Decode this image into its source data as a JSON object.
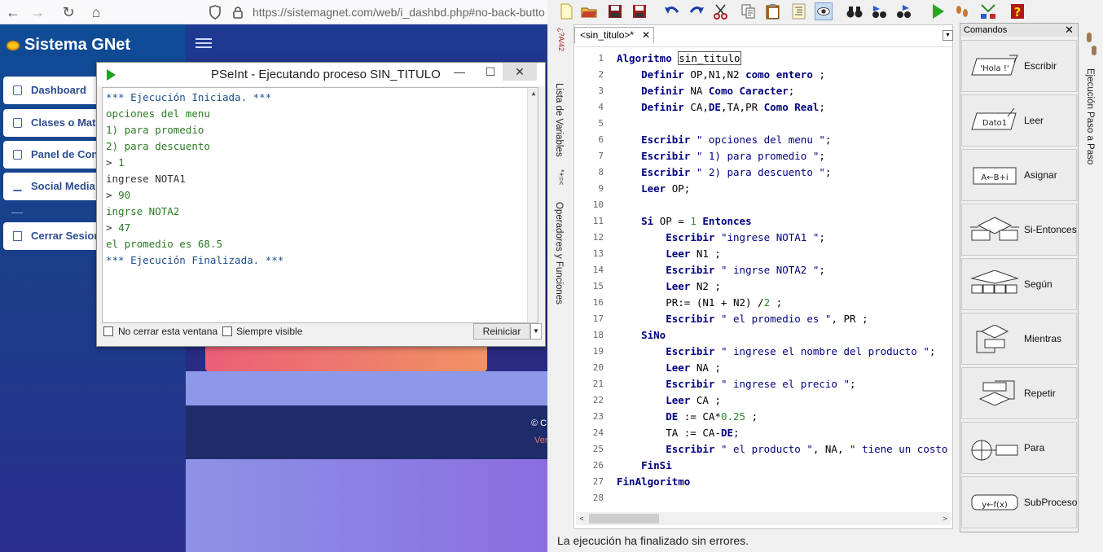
{
  "browser": {
    "url": "https://sistemagnet.com/web/i_dashbd.php#no-back-butto"
  },
  "site": {
    "brand": "Sistema GNet",
    "nav": [
      {
        "label": "Dashboard"
      },
      {
        "label": "Clases o Mate"
      },
      {
        "label": "Panel de Contr"
      },
      {
        "label": "Social Media"
      },
      {
        "label": "Cerrar Sesion"
      }
    ],
    "footer_copy": "© C",
    "footer_version": "Ver"
  },
  "run_window": {
    "title": "PSeInt - Ejecutando proceso SIN_TITULO",
    "console_lines": [
      {
        "text": "*** Ejecución Iniciada. ***",
        "kind": "sys"
      },
      {
        "text": " opciones del menu",
        "kind": "out"
      },
      {
        "text": " 1) para promedio",
        "kind": "out"
      },
      {
        "text": " 2) para descuento",
        "kind": "out"
      },
      {
        "text": "> 1",
        "kind": "in"
      },
      {
        "text": "ingrese NOTA1",
        "kind": "out"
      },
      {
        "text": "> 90",
        "kind": "in"
      },
      {
        "text": " ingrse NOTA2",
        "kind": "out"
      },
      {
        "text": "> 47",
        "kind": "in"
      },
      {
        "text": " el promedio es 68.5",
        "kind": "out"
      },
      {
        "text": "*** Ejecución Finalizada. ***",
        "kind": "sys"
      }
    ],
    "no_close_label": "No cerrar esta ventana",
    "always_visible_label": "Siempre visible",
    "restart_label": "Reiniciar"
  },
  "pseint": {
    "left_tabs": [
      "Lista de Variables",
      "Operadores y Funciones"
    ],
    "right_tab": "Ejecución Paso a Paso",
    "editor_tab": "<sin_titulo>*",
    "code_lines": [
      "Algoritmo sin_titulo",
      "    Definir OP,N1,N2 como entero ;",
      "    Definir NA Como Caracter;",
      "    Definir CA,DE,TA,PR Como Real;",
      "",
      "    Escribir \" opciones del menu \";",
      "    Escribir \" 1) para promedio \";",
      "    Escribir \" 2) para descuento \";",
      "    Leer OP;",
      "",
      "    Si OP = 1 Entonces",
      "        Escribir \"ingrese NOTA1 \";",
      "        Leer N1 ;",
      "        Escribir \" ingrse NOTA2 \";",
      "        Leer N2 ;",
      "        PR:= (N1 + N2) /2 ;",
      "        Escribir \" el promedio es \", PR ;",
      "    SiNo",
      "        Escribir \" ingrese el nombre del producto \";",
      "        Leer NA ;",
      "        Escribir \" ingrese el precio \";",
      "        Leer CA ;",
      "        DE := CA*0.25 ;",
      "        TA := CA-DE;",
      "        Escribir \" el producto \", NA, \" tiene un costo d",
      "    FinSi",
      "FinAlgoritmo",
      ""
    ],
    "commands_title": "Comandos",
    "commands": [
      {
        "label": "Escribir",
        "icon": "write-icon",
        "glyph": "'Hola !'"
      },
      {
        "label": "Leer",
        "icon": "read-icon",
        "glyph": "Dato1"
      },
      {
        "label": "Asignar",
        "icon": "assign-icon",
        "glyph": "A←B+i"
      },
      {
        "label": "Si-Entonces",
        "icon": "if-icon",
        "glyph": ""
      },
      {
        "label": "Según",
        "icon": "switch-icon",
        "glyph": ""
      },
      {
        "label": "Mientras",
        "icon": "while-icon",
        "glyph": ""
      },
      {
        "label": "Repetir",
        "icon": "repeat-icon",
        "glyph": ""
      },
      {
        "label": "Para",
        "icon": "for-icon",
        "glyph": ""
      },
      {
        "label": "SubProceso",
        "icon": "subprocess-icon",
        "glyph": "y←f(x)"
      }
    ],
    "status": "La ejecución ha finalizado sin errores."
  },
  "colors": {
    "keyword": "#000080",
    "number": "#2b8a2b",
    "console_output": "#2b7a22",
    "console_sys": "#1a4e8c"
  }
}
